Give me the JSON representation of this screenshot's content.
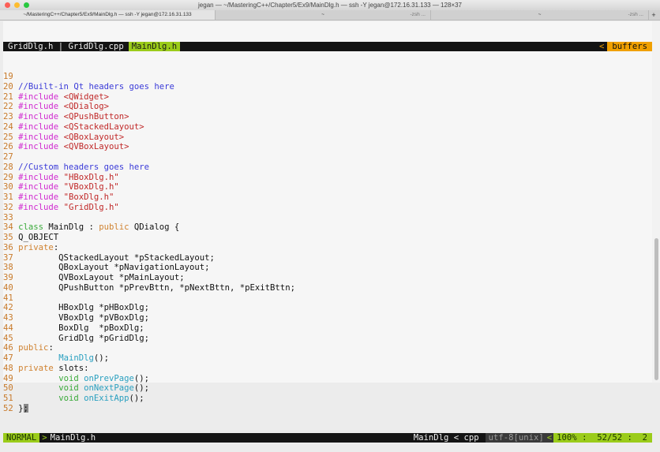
{
  "window": {
    "title": "jegan — ~/MasteringC++/Chapter5/Ex9/MainDlg.h — ssh -Y jegan@172.16.31.133 — 128×37"
  },
  "tabs": [
    {
      "label": "~/MasteringC++/Chapter5/Ex9/MainDlg.h — ssh -Y jegan@172.16.31.133",
      "sub": ""
    },
    {
      "label": "~",
      "sub": "-zsh ..."
    },
    {
      "label": "~",
      "sub": "-zsh ..."
    }
  ],
  "new_tab": "+",
  "buffers": {
    "others": "GridDlg.h | GridDlg.cpp",
    "current": "MainDlg.h",
    "arrow": "<",
    "label": "buffers"
  },
  "code": [
    {
      "n": "19",
      "s": []
    },
    {
      "n": "20",
      "s": [
        [
          "comment",
          "//Built-in Qt headers goes here"
        ]
      ]
    },
    {
      "n": "21",
      "s": [
        [
          "pre",
          "#include "
        ],
        [
          "str",
          "<QWidget>"
        ]
      ]
    },
    {
      "n": "22",
      "s": [
        [
          "pre",
          "#include "
        ],
        [
          "str",
          "<QDialog>"
        ]
      ]
    },
    {
      "n": "23",
      "s": [
        [
          "pre",
          "#include "
        ],
        [
          "str",
          "<QPushButton>"
        ]
      ]
    },
    {
      "n": "24",
      "s": [
        [
          "pre",
          "#include "
        ],
        [
          "str",
          "<QStackedLayout>"
        ]
      ]
    },
    {
      "n": "25",
      "s": [
        [
          "pre",
          "#include "
        ],
        [
          "str",
          "<QBoxLayout>"
        ]
      ]
    },
    {
      "n": "26",
      "s": [
        [
          "pre",
          "#include "
        ],
        [
          "str",
          "<QVBoxLayout>"
        ]
      ]
    },
    {
      "n": "27",
      "s": []
    },
    {
      "n": "28",
      "s": [
        [
          "comment",
          "//Custom headers goes here"
        ]
      ]
    },
    {
      "n": "29",
      "s": [
        [
          "pre",
          "#include "
        ],
        [
          "str",
          "\"HBoxDlg.h\""
        ]
      ]
    },
    {
      "n": "30",
      "s": [
        [
          "pre",
          "#include "
        ],
        [
          "str",
          "\"VBoxDlg.h\""
        ]
      ]
    },
    {
      "n": "31",
      "s": [
        [
          "pre",
          "#include "
        ],
        [
          "str",
          "\"BoxDlg.h\""
        ]
      ]
    },
    {
      "n": "32",
      "s": [
        [
          "pre",
          "#include "
        ],
        [
          "str",
          "\"GridDlg.h\""
        ]
      ]
    },
    {
      "n": "33",
      "s": []
    },
    {
      "n": "34",
      "s": [
        [
          "kw",
          "class"
        ],
        [
          "n",
          " MainDlg : "
        ],
        [
          "acc",
          "public"
        ],
        [
          "n",
          " QDialog {"
        ]
      ]
    },
    {
      "n": "35",
      "s": [
        [
          "n",
          "Q_OBJECT"
        ]
      ]
    },
    {
      "n": "36",
      "s": [
        [
          "acc",
          "private"
        ],
        [
          "n",
          ":"
        ]
      ]
    },
    {
      "n": "37",
      "s": [
        [
          "n",
          "        QStackedLayout *pStackedLayout;"
        ]
      ]
    },
    {
      "n": "38",
      "s": [
        [
          "n",
          "        QBoxLayout *pNavigationLayout;"
        ]
      ]
    },
    {
      "n": "39",
      "s": [
        [
          "n",
          "        QVBoxLayout *pMainLayout;"
        ]
      ]
    },
    {
      "n": "40",
      "s": [
        [
          "n",
          "        QPushButton *pPrevBttn, *pNextBttn, *pExitBttn;"
        ]
      ]
    },
    {
      "n": "41",
      "s": []
    },
    {
      "n": "42",
      "s": [
        [
          "n",
          "        HBoxDlg *pHBoxDlg;"
        ]
      ]
    },
    {
      "n": "43",
      "s": [
        [
          "n",
          "        VBoxDlg *pVBoxDlg;"
        ]
      ]
    },
    {
      "n": "44",
      "s": [
        [
          "n",
          "        BoxDlg  *pBoxDlg;"
        ]
      ]
    },
    {
      "n": "45",
      "s": [
        [
          "n",
          "        GridDlg *pGridDlg;"
        ]
      ]
    },
    {
      "n": "46",
      "s": [
        [
          "acc",
          "public"
        ],
        [
          "n",
          ":"
        ]
      ]
    },
    {
      "n": "47",
      "s": [
        [
          "n",
          "        "
        ],
        [
          "fn",
          "MainDlg"
        ],
        [
          "n",
          "();"
        ]
      ]
    },
    {
      "n": "48",
      "s": [
        [
          "acc",
          "private"
        ],
        [
          "n",
          " slots:"
        ]
      ]
    },
    {
      "n": "49",
      "s": [
        [
          "n",
          "        "
        ],
        [
          "kw",
          "void"
        ],
        [
          "n",
          " "
        ],
        [
          "fn",
          "onPrevPage"
        ],
        [
          "n",
          "();"
        ]
      ]
    },
    {
      "n": "50",
      "s": [
        [
          "n",
          "        "
        ],
        [
          "kw",
          "void"
        ],
        [
          "n",
          " "
        ],
        [
          "fn",
          "onNextPage"
        ],
        [
          "n",
          "();"
        ]
      ]
    },
    {
      "n": "51",
      "s": [
        [
          "n",
          "        "
        ],
        [
          "kw",
          "void"
        ],
        [
          "n",
          " "
        ],
        [
          "fn",
          "onExitApp"
        ],
        [
          "n",
          "();"
        ]
      ]
    },
    {
      "n": "52",
      "s": [
        [
          "n",
          "}"
        ],
        [
          "cursor",
          ";"
        ]
      ]
    }
  ],
  "status": {
    "mode": "NORMAL",
    "sep": ">",
    "file": "MainDlg.h",
    "tag": "MainDlg < cpp",
    "encoding": "utf-8[unix]",
    "arrow": "<",
    "percent": "100%",
    "position": "52/52",
    "column": "2"
  }
}
